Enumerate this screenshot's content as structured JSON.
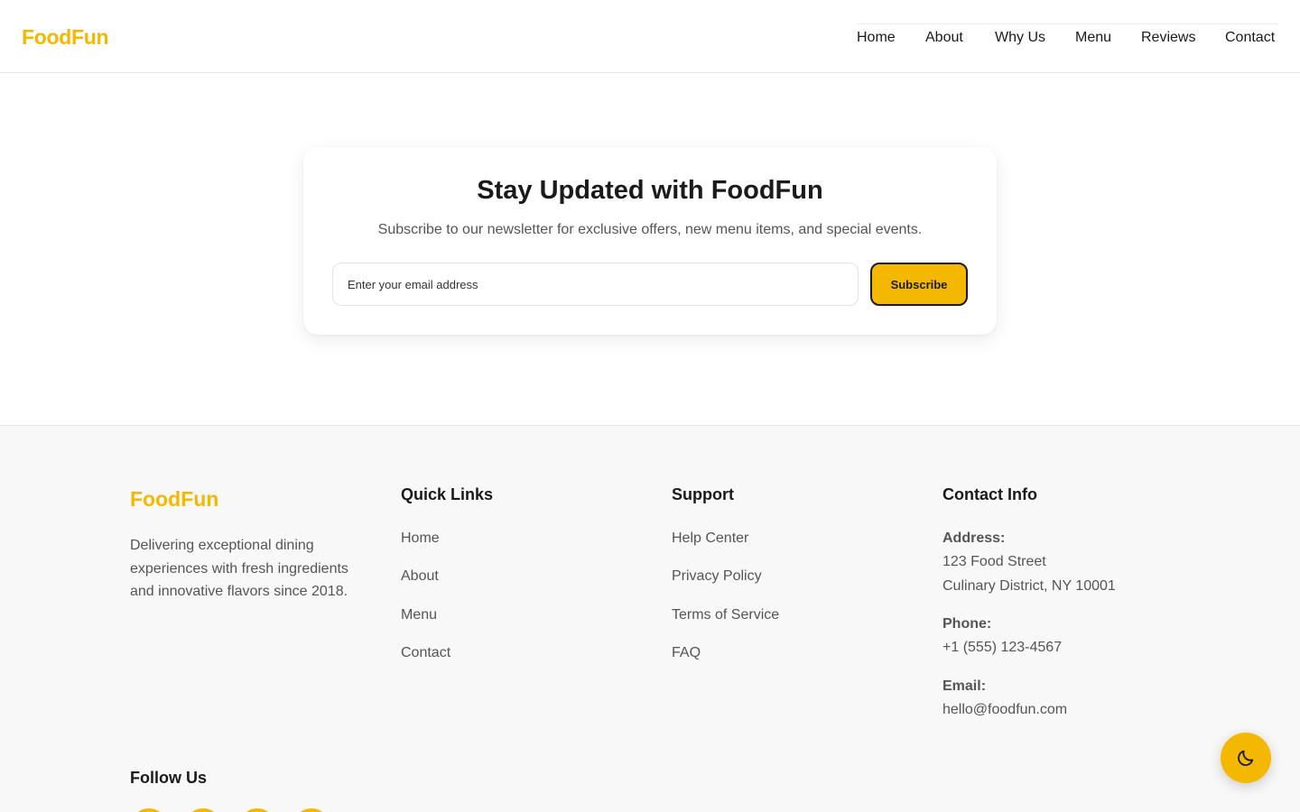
{
  "brand": {
    "name": "FoodFun",
    "accent": "#f5b800"
  },
  "nav": {
    "items": [
      "Home",
      "About",
      "Why Us",
      "Menu",
      "Reviews",
      "Contact"
    ]
  },
  "newsletter": {
    "title": "Stay Updated with FoodFun",
    "subtitle": "Subscribe to our newsletter for exclusive offers, new menu items, and special events.",
    "placeholder": "Enter your email address",
    "button": "Subscribe"
  },
  "footer": {
    "brand": "FoodFun",
    "description": "Delivering exceptional dining experiences with fresh ingredients and innovative flavors since 2018.",
    "quick_links": {
      "title": "Quick Links",
      "items": [
        "Home",
        "About",
        "Menu",
        "Contact"
      ]
    },
    "support": {
      "title": "Support",
      "items": [
        "Help Center",
        "Privacy Policy",
        "Terms of Service",
        "FAQ"
      ]
    },
    "contact": {
      "title": "Contact Info",
      "address_label": "Address:",
      "address_line1": "123 Food Street",
      "address_line2": "Culinary District, NY 10001",
      "phone_label": "Phone:",
      "phone": "+1 (555) 123-4567",
      "email_label": "Email:",
      "email": "hello@foodfun.com"
    },
    "follow_title": "Follow Us"
  },
  "theme_toggle": {
    "icon": "moon-icon"
  }
}
